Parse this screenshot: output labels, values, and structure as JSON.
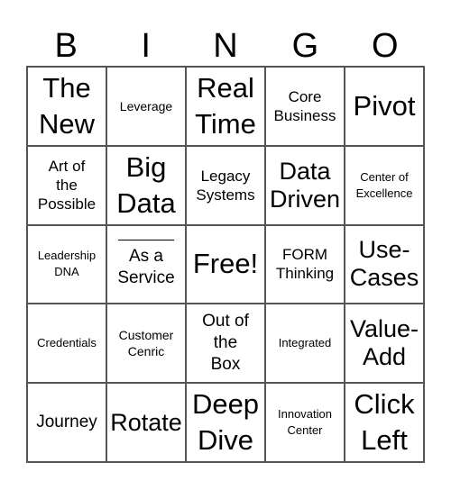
{
  "header": {
    "letters": [
      "B",
      "I",
      "N",
      "G",
      "O"
    ]
  },
  "cells": [
    {
      "text": "The\nNew",
      "size": "s-xl"
    },
    {
      "text": "Leverage",
      "size": "s-xs"
    },
    {
      "text": "Real\nTime",
      "size": "s-xl"
    },
    {
      "text": "Core\nBusiness",
      "size": "s-s"
    },
    {
      "text": "Pivot",
      "size": "s-xl"
    },
    {
      "text": "Art of\nthe\nPossible",
      "size": "s-s"
    },
    {
      "text": "Big\nData",
      "size": "s-xl"
    },
    {
      "text": "Legacy\nSystems",
      "size": "s-s"
    },
    {
      "text": "Data\nDriven",
      "size": "s-l"
    },
    {
      "text": "Center of\nExcellence",
      "size": "s-xxs"
    },
    {
      "text": "Leadership\nDNA",
      "size": "s-xxs"
    },
    {
      "text": "As a\nService",
      "size": "s-m",
      "blank": true
    },
    {
      "text": "Free!",
      "size": "s-xl"
    },
    {
      "text": "FORM\nThinking",
      "size": "s-s"
    },
    {
      "text": "Use-\nCases",
      "size": "s-l"
    },
    {
      "text": "Credentials",
      "size": "s-xxs"
    },
    {
      "text": "Customer\nCenric",
      "size": "s-xs"
    },
    {
      "text": "Out of\nthe\nBox",
      "size": "s-m"
    },
    {
      "text": "Integrated",
      "size": "s-xxs"
    },
    {
      "text": "Value-\nAdd",
      "size": "s-l"
    },
    {
      "text": "Journey",
      "size": "s-m"
    },
    {
      "text": "Rotate",
      "size": "s-l"
    },
    {
      "text": "Deep\nDive",
      "size": "s-xl"
    },
    {
      "text": "Innovation\nCenter",
      "size": "s-xxs"
    },
    {
      "text": "Click\nLeft",
      "size": "s-xl"
    }
  ]
}
